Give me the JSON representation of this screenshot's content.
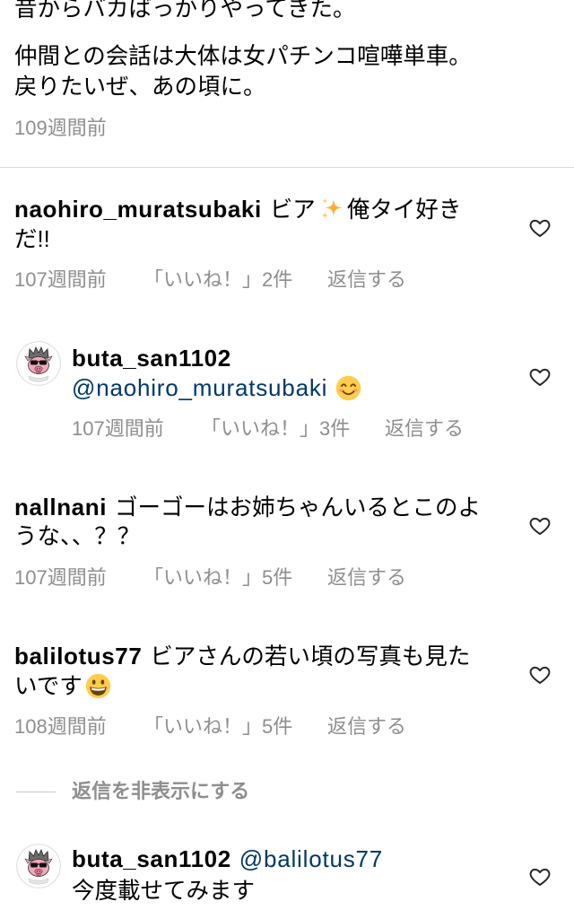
{
  "caption": {
    "lines": [
      "昔からバカばっかりやってきた。",
      "仲間との会話は大体は女パチンコ喧嘩単車。",
      "戻りたいぜ、あの頃に。"
    ],
    "time": "109週間前"
  },
  "comments": [
    {
      "username": "naohiro_muratsubaki",
      "text_segments": [
        "ビア",
        "俺タイ好き",
        "だ!!"
      ],
      "emoji": "sparkles-emoji",
      "time": "107週間前",
      "likes": "「いいね！」2件",
      "reply_label": "返信する",
      "liked": false,
      "replies": [
        {
          "username": "buta_san1102",
          "mention": "@naohiro_muratsubaki",
          "emoji": "smiling-face-with-smiling-eyes-emoji",
          "avatar": "pig-with-sunglasses-avatar",
          "time": "107週間前",
          "likes": "「いいね！」3件",
          "reply_label": "返信する",
          "liked": false
        }
      ]
    },
    {
      "username": "nallnani",
      "text_segments": [
        "ゴーゴーはお姉ちゃんいるとこのよ",
        "うな、、？？"
      ],
      "time": "107週間前",
      "likes": "「いいね！」5件",
      "reply_label": "返信する",
      "liked": false
    },
    {
      "username": "balilotus77",
      "text_segments": [
        "ビアさんの若い頃の写真も見た",
        "いです"
      ],
      "emoji": "grinning-face-emoji",
      "time": "108週間前",
      "likes": "「いいね！」5件",
      "reply_label": "返信する",
      "liked": false,
      "hide_replies_label": "返信を非表示にする",
      "replies": [
        {
          "username": "buta_san1102",
          "mention": "@balilotus77",
          "text_segments": [
            "今度載せてみます"
          ],
          "avatar": "pig-with-sunglasses-avatar",
          "liked": false
        }
      ]
    }
  ],
  "colors": {
    "text": "#000000",
    "secondary": "#8e8e8e",
    "mention": "#00376b",
    "divider": "#dbdbdb"
  }
}
